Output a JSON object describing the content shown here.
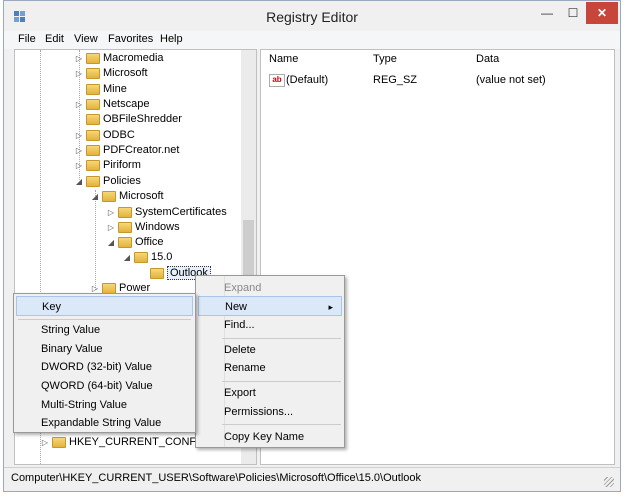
{
  "window": {
    "title": "Registry Editor",
    "minimize": "—",
    "maximize": "☐",
    "close": "✕"
  },
  "menu": [
    "File",
    "Edit",
    "View",
    "Favorites",
    "Help"
  ],
  "tree": {
    "items": [
      {
        "label": "Macromedia",
        "toggle": "▷"
      },
      {
        "label": "Microsoft",
        "toggle": "▷"
      },
      {
        "label": "Mine",
        "toggle": ""
      },
      {
        "label": "Netscape",
        "toggle": "▷"
      },
      {
        "label": "OBFileShredder",
        "toggle": ""
      },
      {
        "label": "ODBC",
        "toggle": "▷"
      },
      {
        "label": "PDFCreator.net",
        "toggle": "▷"
      },
      {
        "label": "Piriform",
        "toggle": "▷"
      },
      {
        "label": "Policies",
        "toggle": "◢"
      },
      {
        "label": "Microsoft",
        "toggle": "◢"
      },
      {
        "label": "SystemCertificates",
        "toggle": "▷"
      },
      {
        "label": "Windows",
        "toggle": "▷"
      },
      {
        "label": "Office",
        "toggle": "◢"
      },
      {
        "label": "15.0",
        "toggle": "◢"
      },
      {
        "label": "Outlook",
        "toggle": ""
      },
      {
        "label": "Power",
        "toggle": "▷"
      },
      {
        "label": "HKEY_CURRENT_CONFIG",
        "toggle": "▷"
      }
    ]
  },
  "list": {
    "columns": [
      "Name",
      "Type",
      "Data"
    ],
    "rows": [
      {
        "name": "(Default)",
        "type": "REG_SZ",
        "data": "(value not set)",
        "icon": "ab"
      }
    ]
  },
  "context_menu": {
    "items": [
      "Expand",
      "New",
      "Find...",
      "Delete",
      "Rename",
      "Export",
      "Permissions...",
      "Copy Key Name"
    ],
    "submenu_arrow": "▸"
  },
  "new_submenu": {
    "items": [
      "Key",
      "String Value",
      "Binary Value",
      "DWORD (32-bit) Value",
      "QWORD (64-bit) Value",
      "Multi-String Value",
      "Expandable String Value"
    ]
  },
  "status": {
    "path": "Computer\\HKEY_CURRENT_USER\\Software\\Policies\\Microsoft\\Office\\15.0\\Outlook"
  }
}
